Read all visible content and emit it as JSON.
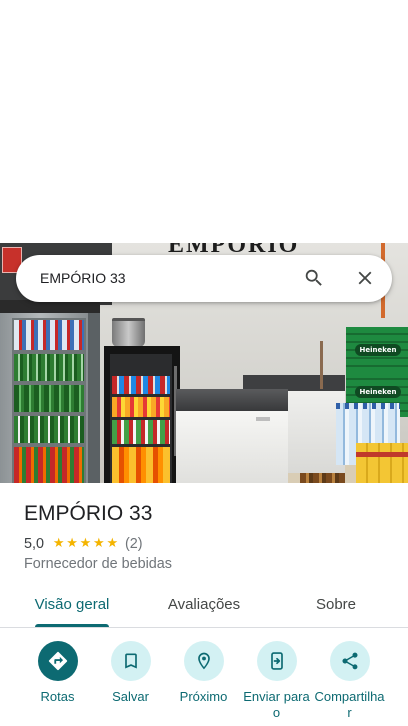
{
  "search": {
    "query": "EMPÓRIO 33",
    "search_icon": "search-icon",
    "close_icon": "close-icon"
  },
  "photo": {
    "sign_text": "EMPÓRIO",
    "crate_label": "Heineken"
  },
  "place": {
    "name": "EMPÓRIO 33",
    "rating": "5,0",
    "stars": 5,
    "review_count": "(2)",
    "category": "Fornecedor de bebidas"
  },
  "tabs": [
    {
      "label": "Visão geral",
      "active": true
    },
    {
      "label": "Avaliações",
      "active": false
    },
    {
      "label": "Sobre",
      "active": false
    }
  ],
  "actions": [
    {
      "label": "Rotas",
      "icon": "directions-icon",
      "primary": true
    },
    {
      "label": "Salvar",
      "icon": "bookmark-icon",
      "primary": false
    },
    {
      "label": "Próximo",
      "icon": "nearby-icon",
      "primary": false
    },
    {
      "label": "Enviar para o",
      "icon": "send-to-phone-icon",
      "primary": false
    },
    {
      "label": "Compartilhar",
      "icon": "share-icon",
      "primary": false
    }
  ],
  "colors": {
    "accent": "#0d6a72",
    "accent_light": "#d3f1f3",
    "star": "#f4b400",
    "text": "#202124",
    "secondary_text": "#70757a"
  }
}
